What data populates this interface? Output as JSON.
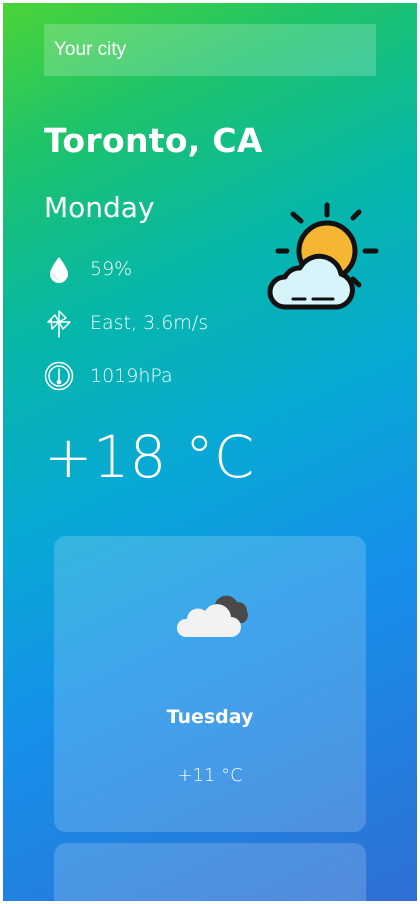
{
  "search": {
    "placeholder": "Your city",
    "value": ""
  },
  "current": {
    "city": "Toronto, CA",
    "day": "Monday",
    "humidity": "59%",
    "wind": "East, 3.6m/s",
    "pressure": "1019hPa",
    "temperature": "+18 °C",
    "icon": "sun-behind-cloud-icon"
  },
  "forecast": [
    {
      "day": "Tuesday",
      "temperature": "+11 °C",
      "icon": "broken-clouds-icon"
    },
    {
      "day": "",
      "temperature": "",
      "icon": ""
    }
  ],
  "colors": {
    "gradient": [
      "#4cd437",
      "#06b7a8",
      "#1690ea",
      "#2f6fd3"
    ],
    "sun": "#f5b731",
    "cloud_light": "#d7f4fb",
    "cloud_dark": "#4a4a4a"
  }
}
